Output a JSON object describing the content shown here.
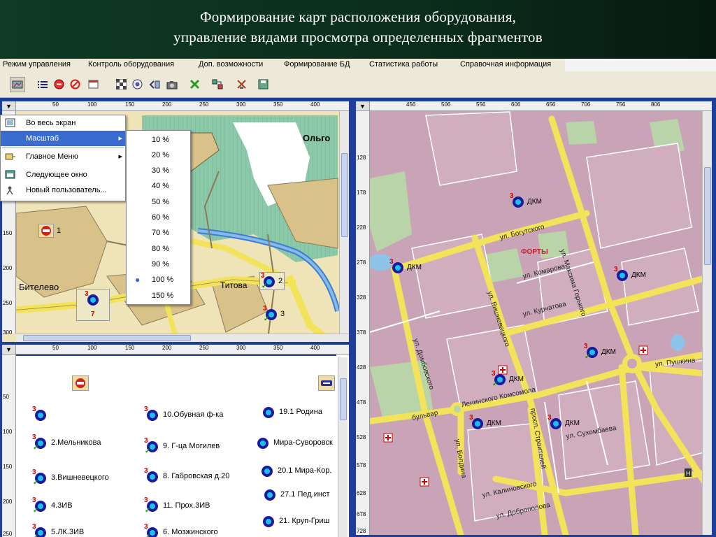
{
  "banner": {
    "line1": "Формирование карт расположения оборудования,",
    "line2": "управление видами просмотра определенных фрагментов"
  },
  "menubar": [
    "Режим управления",
    "Контроль оборудования",
    "Доп. возможности",
    "Формирование БД",
    "Статистика работы",
    "Справочная информация"
  ],
  "toolbar_icons": [
    "map-select-icon",
    "list-icon",
    "stop-red-icon",
    "no-entry-icon",
    "window-icon",
    "checkered-icon",
    "target-icon",
    "back-arrows-icon",
    "camera-icon",
    "cross-green-icon",
    "transfer-icon",
    "tools-icon",
    "save-icon"
  ],
  "left_top": {
    "ruler_h": [
      "50",
      "100",
      "150",
      "200",
      "250",
      "300",
      "350",
      "400"
    ],
    "ruler_v": [
      "150",
      "200",
      "250",
      "300"
    ],
    "labels": {
      "olgo": "Ольго",
      "bitelevo": "Бителево",
      "titova": "Титова"
    },
    "markers": [
      {
        "num": "1"
      },
      {
        "num": "2"
      },
      {
        "num": "3"
      },
      {
        "num": "7"
      }
    ]
  },
  "context_menu": {
    "items": [
      "Во весь экран",
      "Масштаб",
      "Главное Меню",
      "Следующее окно",
      "Новый пользователь..."
    ],
    "selected": 1
  },
  "zoom_menu": {
    "items": [
      "10 %",
      "20 %",
      "30 %",
      "40 %",
      "50 %",
      "60 %",
      "70 %",
      "80 %",
      "90 %",
      "100 %",
      "150 %"
    ],
    "checked": 9
  },
  "left_bottom": {
    "ruler_h": [
      "50",
      "100",
      "150",
      "200",
      "250",
      "300",
      "350",
      "400"
    ],
    "ruler_v": [
      "50",
      "100",
      "150",
      "200",
      "250"
    ],
    "col1": [
      "",
      "2.Мельникова",
      "3.Вишневецкого",
      "4.3ИВ",
      "5.ЛК.3ИВ"
    ],
    "col2": [
      "10.Обувная ф-ка",
      "9. Г-ца Могилев",
      "8. Габровская д.20",
      "11. Прох.3ИВ",
      "6. Мозжинского"
    ],
    "col3": [
      "19.1 Родина",
      "Мира-Суворовск",
      "20.1 Мира-Кор.",
      "27.1 Пед.инст",
      "21. Круп-Гриш"
    ]
  },
  "right_map": {
    "ruler_h": [
      "456",
      "506",
      "556",
      "606",
      "656",
      "706",
      "756",
      "806"
    ],
    "ruler_v": [
      "128",
      "178",
      "228",
      "278",
      "328",
      "378",
      "428",
      "478",
      "528",
      "578",
      "628",
      "678",
      "728"
    ],
    "district": "ФОРТЫ",
    "streets": [
      "ул. Богутского",
      "ул. Максима Горького",
      "ул. Комарова",
      "ул. Курчатова",
      "ул. Вишневецкого",
      "ул. Домбовского",
      "Ленинского Комсомола",
      "бульвар",
      "ул. Пушкина",
      "просп. Строителей",
      "ул. Сухомбаева",
      "ул. Калиновского",
      "ул. Доброполова",
      "ул. Болдина"
    ],
    "dkm_label": "ДКМ"
  },
  "colors": {
    "frame": "#1f3d9a",
    "road": "#f2e35a",
    "block": "#c9a4b6",
    "park": "#b8d4a8",
    "marker_blue": "#1a1aa0",
    "marker_cyan": "#19c3e6"
  }
}
